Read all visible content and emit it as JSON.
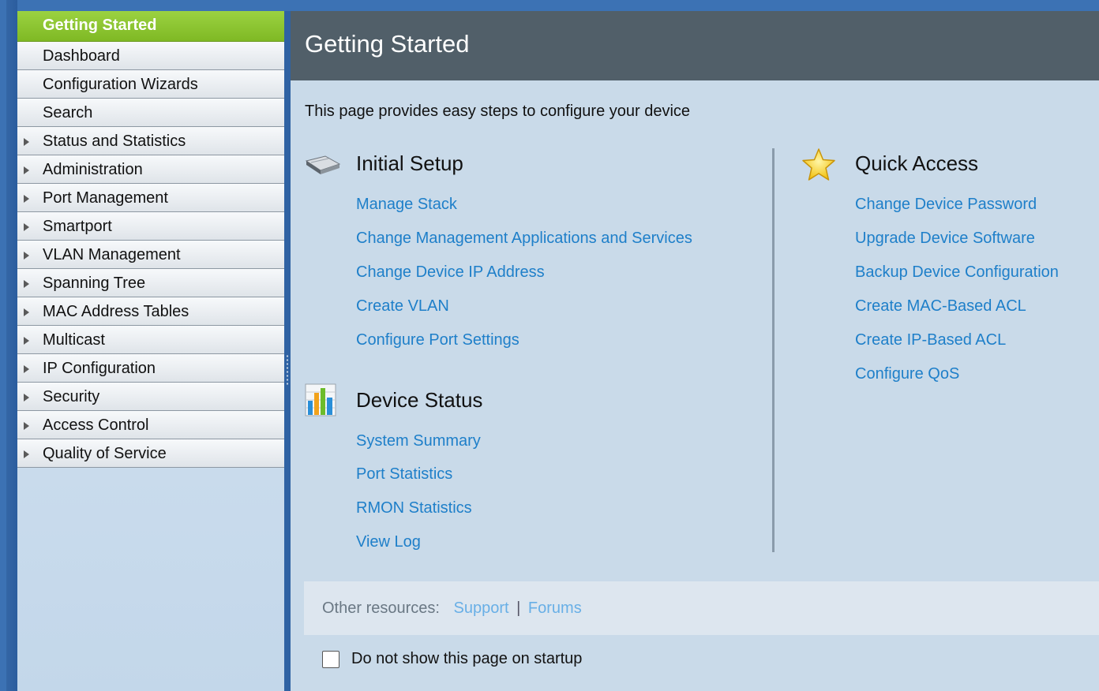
{
  "sidebar": {
    "items": [
      {
        "label": "Getting Started",
        "active": true,
        "expandable": false
      },
      {
        "label": "Dashboard",
        "expandable": false
      },
      {
        "label": "Configuration Wizards",
        "expandable": false
      },
      {
        "label": "Search",
        "expandable": false
      },
      {
        "label": "Status and Statistics",
        "expandable": true
      },
      {
        "label": "Administration",
        "expandable": true
      },
      {
        "label": "Port Management",
        "expandable": true
      },
      {
        "label": "Smartport",
        "expandable": true
      },
      {
        "label": "VLAN Management",
        "expandable": true
      },
      {
        "label": "Spanning Tree",
        "expandable": true
      },
      {
        "label": "MAC Address Tables",
        "expandable": true
      },
      {
        "label": "Multicast",
        "expandable": true
      },
      {
        "label": "IP Configuration",
        "expandable": true
      },
      {
        "label": "Security",
        "expandable": true
      },
      {
        "label": "Access Control",
        "expandable": true
      },
      {
        "label": "Quality of Service",
        "expandable": true
      }
    ]
  },
  "header": {
    "title": "Getting Started"
  },
  "intro": "This page provides easy steps to configure your device",
  "initial_setup": {
    "title": "Initial Setup",
    "icon": "switch-device-icon",
    "links": [
      "Manage Stack",
      "Change Management Applications and Services",
      "Change Device IP Address",
      "Create VLAN",
      "Configure Port Settings"
    ]
  },
  "device_status": {
    "title": "Device Status",
    "icon": "bar-chart-icon",
    "links": [
      "System Summary",
      "Port Statistics",
      "RMON Statistics",
      "View Log"
    ]
  },
  "quick_access": {
    "title": "Quick Access",
    "icon": "star-icon",
    "links": [
      "Change Device Password",
      "Upgrade Device Software",
      "Backup Device Configuration",
      "Create MAC-Based ACL",
      "Create IP-Based ACL",
      "Configure QoS"
    ]
  },
  "resources": {
    "label": "Other resources:",
    "support": "Support",
    "separator": "|",
    "forums": "Forums"
  },
  "startup": {
    "label": "Do not show this page on startup",
    "checked": false
  },
  "colors": {
    "header_bg": "#515f69",
    "link": "#1e7fc9",
    "active_nav": "#8cc531",
    "frame": "#3c72b4"
  }
}
